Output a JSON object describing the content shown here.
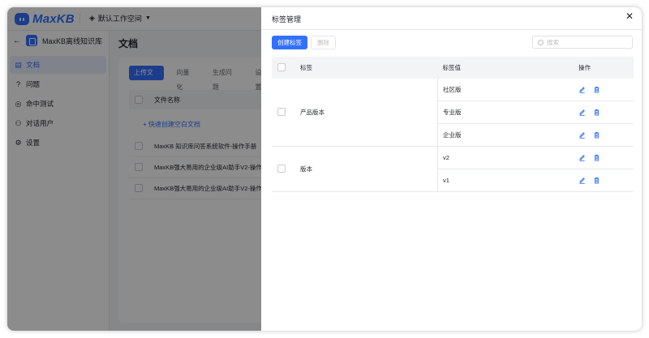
{
  "app": {
    "logo_text": "MaxKB",
    "workspace": "默认工作空间",
    "brand_color": "#3370ff"
  },
  "sidebar": {
    "kb_name": "MaxKB离线知识库",
    "items": [
      {
        "label": "文档",
        "icon": "document-icon",
        "active": true
      },
      {
        "label": "问题",
        "icon": "question-icon",
        "active": false
      },
      {
        "label": "命中测试",
        "icon": "target-icon",
        "active": false
      },
      {
        "label": "对话用户",
        "icon": "user-icon",
        "active": false
      },
      {
        "label": "设置",
        "icon": "gear-icon",
        "active": false
      }
    ]
  },
  "main": {
    "title": "文档",
    "tabs": [
      "上传文档",
      "向量化",
      "生成问题",
      "设置"
    ],
    "column_file_name": "文件名称",
    "quick_create": "+ 快速创建空白文档",
    "docs": [
      "MaxKB 知识库问答系统软件-操作手册",
      "MaxKB强大易用的企业级AI助手V2-操作",
      "MaxKB强大易用的企业级AI助手V2-操作"
    ]
  },
  "drawer": {
    "title": "标签管理",
    "create_button": "创建标签",
    "delete_button": "删除",
    "search_placeholder": "搜索",
    "headers": {
      "tag": "标签",
      "value": "标签值",
      "action": "操作"
    },
    "groups": [
      {
        "tag": "产品版本",
        "values": [
          "社区版",
          "专业版",
          "企业版"
        ]
      },
      {
        "tag": "版本",
        "values": [
          "v2",
          "v1"
        ]
      }
    ]
  }
}
